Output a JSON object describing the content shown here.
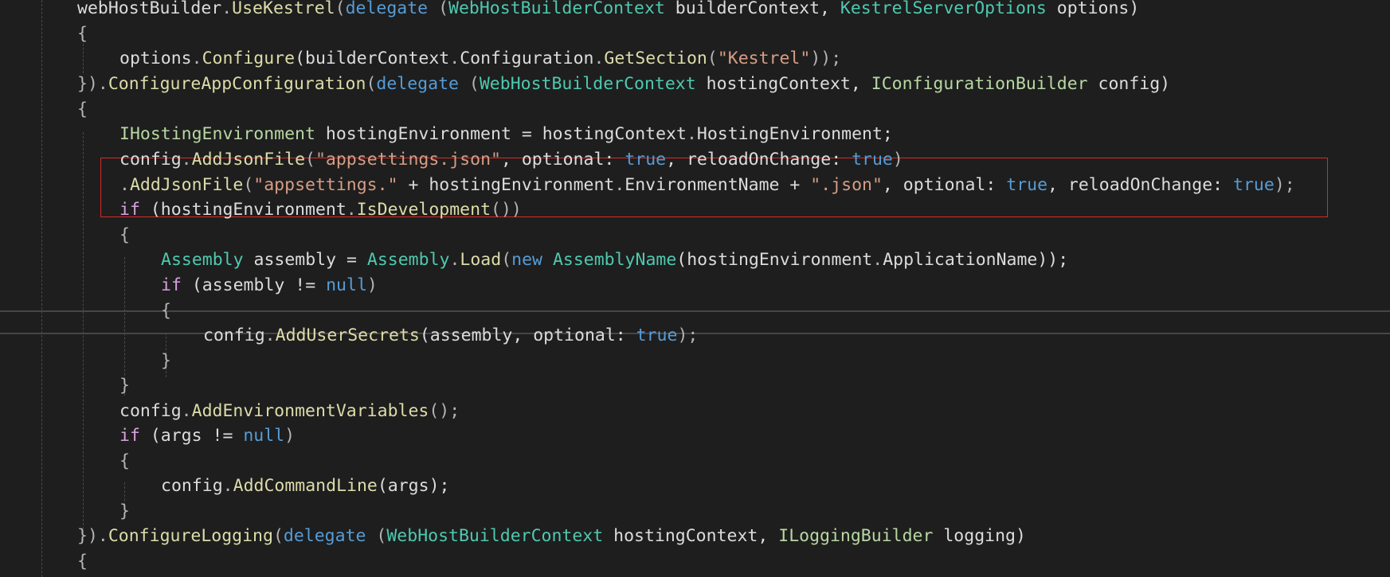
{
  "editor": {
    "theme": "dark",
    "colors": {
      "background": "#1e1e1e",
      "keyword": "#569cd6",
      "control_keyword": "#d8a0df",
      "type": "#4ec9b0",
      "interface": "#b8d7a3",
      "method": "#dcdcaa",
      "string": "#d69d85",
      "identifier": "#dcdcdc",
      "highlight_box": "#d42a2a"
    },
    "lines": [
      [
        {
          "t": "webHostBuilder",
          "c": "id"
        },
        {
          "t": ".",
          "c": "punct"
        },
        {
          "t": "UseKestrel",
          "c": "method"
        },
        {
          "t": "(",
          "c": "punct"
        },
        {
          "t": "delegate",
          "c": "kw"
        },
        {
          "t": " (",
          "c": "punct"
        },
        {
          "t": "WebHostBuilderContext",
          "c": "type"
        },
        {
          "t": " builderContext, ",
          "c": "id"
        },
        {
          "t": "KestrelServerOptions",
          "c": "type"
        },
        {
          "t": " options)",
          "c": "id"
        }
      ],
      [
        {
          "t": "{",
          "c": "punct"
        }
      ],
      [
        {
          "t": "options",
          "c": "id"
        },
        {
          "t": ".",
          "c": "punct"
        },
        {
          "t": "Configure",
          "c": "method"
        },
        {
          "t": "(builderContext",
          "c": "id"
        },
        {
          "t": ".",
          "c": "punct"
        },
        {
          "t": "Configuration",
          "c": "id"
        },
        {
          "t": ".",
          "c": "punct"
        },
        {
          "t": "GetSection",
          "c": "method"
        },
        {
          "t": "(",
          "c": "punct"
        },
        {
          "t": "\"Kestrel\"",
          "c": "str"
        },
        {
          "t": "));",
          "c": "punct"
        }
      ],
      [
        {
          "t": "})",
          "c": "punct"
        },
        {
          "t": ".",
          "c": "punct"
        },
        {
          "t": "ConfigureAppConfiguration",
          "c": "method"
        },
        {
          "t": "(",
          "c": "punct"
        },
        {
          "t": "delegate",
          "c": "kw"
        },
        {
          "t": " (",
          "c": "punct"
        },
        {
          "t": "WebHostBuilderContext",
          "c": "type"
        },
        {
          "t": " hostingContext, ",
          "c": "id"
        },
        {
          "t": "IConfigurationBuilder",
          "c": "iface"
        },
        {
          "t": " config)",
          "c": "id"
        }
      ],
      [
        {
          "t": "{",
          "c": "punct"
        }
      ],
      [
        {
          "t": "IHostingEnvironment",
          "c": "iface"
        },
        {
          "t": " hostingEnvironment = hostingContext",
          "c": "id"
        },
        {
          "t": ".",
          "c": "punct"
        },
        {
          "t": "HostingEnvironment;",
          "c": "id"
        }
      ],
      [
        {
          "t": "config",
          "c": "id"
        },
        {
          "t": ".",
          "c": "punct"
        },
        {
          "t": "AddJsonFile",
          "c": "method"
        },
        {
          "t": "(",
          "c": "punct"
        },
        {
          "t": "\"appsettings.json\"",
          "c": "str"
        },
        {
          "t": ", optional: ",
          "c": "id"
        },
        {
          "t": "true",
          "c": "kw"
        },
        {
          "t": ", reloadOnChange: ",
          "c": "id"
        },
        {
          "t": "true",
          "c": "kw"
        },
        {
          "t": ")",
          "c": "punct"
        }
      ],
      [
        {
          "t": ".",
          "c": "punct"
        },
        {
          "t": "AddJsonFile",
          "c": "method"
        },
        {
          "t": "(",
          "c": "punct"
        },
        {
          "t": "\"appsettings.\"",
          "c": "str"
        },
        {
          "t": " + hostingEnvironment",
          "c": "id"
        },
        {
          "t": ".",
          "c": "punct"
        },
        {
          "t": "EnvironmentName + ",
          "c": "id"
        },
        {
          "t": "\".json\"",
          "c": "str"
        },
        {
          "t": ", optional: ",
          "c": "id"
        },
        {
          "t": "true",
          "c": "kw"
        },
        {
          "t": ", reloadOnChange: ",
          "c": "id"
        },
        {
          "t": "true",
          "c": "kw"
        },
        {
          "t": ");",
          "c": "punct"
        }
      ],
      [
        {
          "t": "if",
          "c": "ctl"
        },
        {
          "t": " (hostingEnvironment",
          "c": "id"
        },
        {
          "t": ".",
          "c": "punct"
        },
        {
          "t": "IsDevelopment",
          "c": "method"
        },
        {
          "t": "())",
          "c": "punct"
        }
      ],
      [
        {
          "t": "{",
          "c": "punct"
        }
      ],
      [
        {
          "t": "Assembly",
          "c": "type"
        },
        {
          "t": " assembly = ",
          "c": "id"
        },
        {
          "t": "Assembly",
          "c": "type"
        },
        {
          "t": ".",
          "c": "punct"
        },
        {
          "t": "Load",
          "c": "method"
        },
        {
          "t": "(",
          "c": "punct"
        },
        {
          "t": "new",
          "c": "kw"
        },
        {
          "t": " ",
          "c": "id"
        },
        {
          "t": "AssemblyName",
          "c": "type"
        },
        {
          "t": "(hostingEnvironment",
          "c": "id"
        },
        {
          "t": ".",
          "c": "punct"
        },
        {
          "t": "ApplicationName));",
          "c": "id"
        }
      ],
      [
        {
          "t": "if",
          "c": "ctl"
        },
        {
          "t": " (assembly != ",
          "c": "id"
        },
        {
          "t": "null",
          "c": "kw"
        },
        {
          "t": ")",
          "c": "punct"
        }
      ],
      [
        {
          "t": "{",
          "c": "punct"
        }
      ],
      [
        {
          "t": "config",
          "c": "id"
        },
        {
          "t": ".",
          "c": "punct"
        },
        {
          "t": "AddUserSecrets",
          "c": "method"
        },
        {
          "t": "(assembly, optional: ",
          "c": "id"
        },
        {
          "t": "true",
          "c": "kw"
        },
        {
          "t": ");",
          "c": "punct"
        }
      ],
      [
        {
          "t": "}",
          "c": "punct"
        }
      ],
      [
        {
          "t": "}",
          "c": "punct"
        }
      ],
      [
        {
          "t": "config",
          "c": "id"
        },
        {
          "t": ".",
          "c": "punct"
        },
        {
          "t": "AddEnvironmentVariables",
          "c": "method"
        },
        {
          "t": "();",
          "c": "punct"
        }
      ],
      [
        {
          "t": "if",
          "c": "ctl"
        },
        {
          "t": " (args != ",
          "c": "id"
        },
        {
          "t": "null",
          "c": "kw"
        },
        {
          "t": ")",
          "c": "punct"
        }
      ],
      [
        {
          "t": "{",
          "c": "punct"
        }
      ],
      [
        {
          "t": "config",
          "c": "id"
        },
        {
          "t": ".",
          "c": "punct"
        },
        {
          "t": "AddCommandLine",
          "c": "method"
        },
        {
          "t": "(args);",
          "c": "id"
        }
      ],
      [
        {
          "t": "}",
          "c": "punct"
        }
      ],
      [
        {
          "t": "})",
          "c": "punct"
        },
        {
          "t": ".",
          "c": "punct"
        },
        {
          "t": "ConfigureLogging",
          "c": "method"
        },
        {
          "t": "(",
          "c": "punct"
        },
        {
          "t": "delegate",
          "c": "kw"
        },
        {
          "t": " (",
          "c": "punct"
        },
        {
          "t": "WebHostBuilderContext",
          "c": "type"
        },
        {
          "t": " hostingContext, ",
          "c": "id"
        },
        {
          "t": "ILoggingBuilder",
          "c": "iface"
        },
        {
          "t": " logging)",
          "c": "id"
        }
      ],
      [
        {
          "t": "{",
          "c": "punct"
        }
      ]
    ]
  }
}
